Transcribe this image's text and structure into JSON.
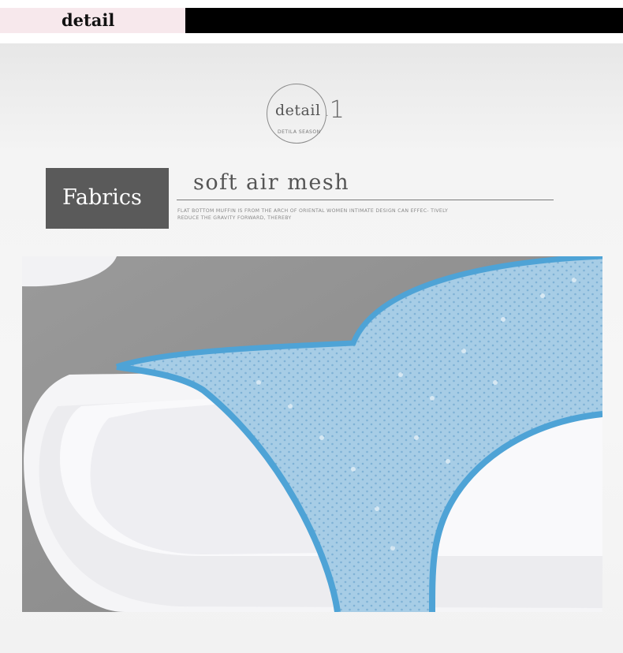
{
  "header": {
    "tab_label": "detail"
  },
  "badge": {
    "word": "detail",
    "subtitle": "DETILA SEASON",
    "number": "1"
  },
  "section": {
    "label": "Fabrics",
    "title": "soft air mesh",
    "description": "FLAT BOTTOM MUFFIN IS FROM THE ARCH OF ORIENTAL WOMEN INTIMATE DESIGN CAN EFFEC- TIVELY REDUCE THE GRAVITY FORWARD, THEREBY"
  },
  "photo": {
    "subject": "sandal-mesh-closeup",
    "colors": {
      "mesh": "#a9cfe8",
      "trim": "#5aaad8",
      "sole": "#f4f4f6",
      "ground": "#8f8f8f"
    }
  }
}
